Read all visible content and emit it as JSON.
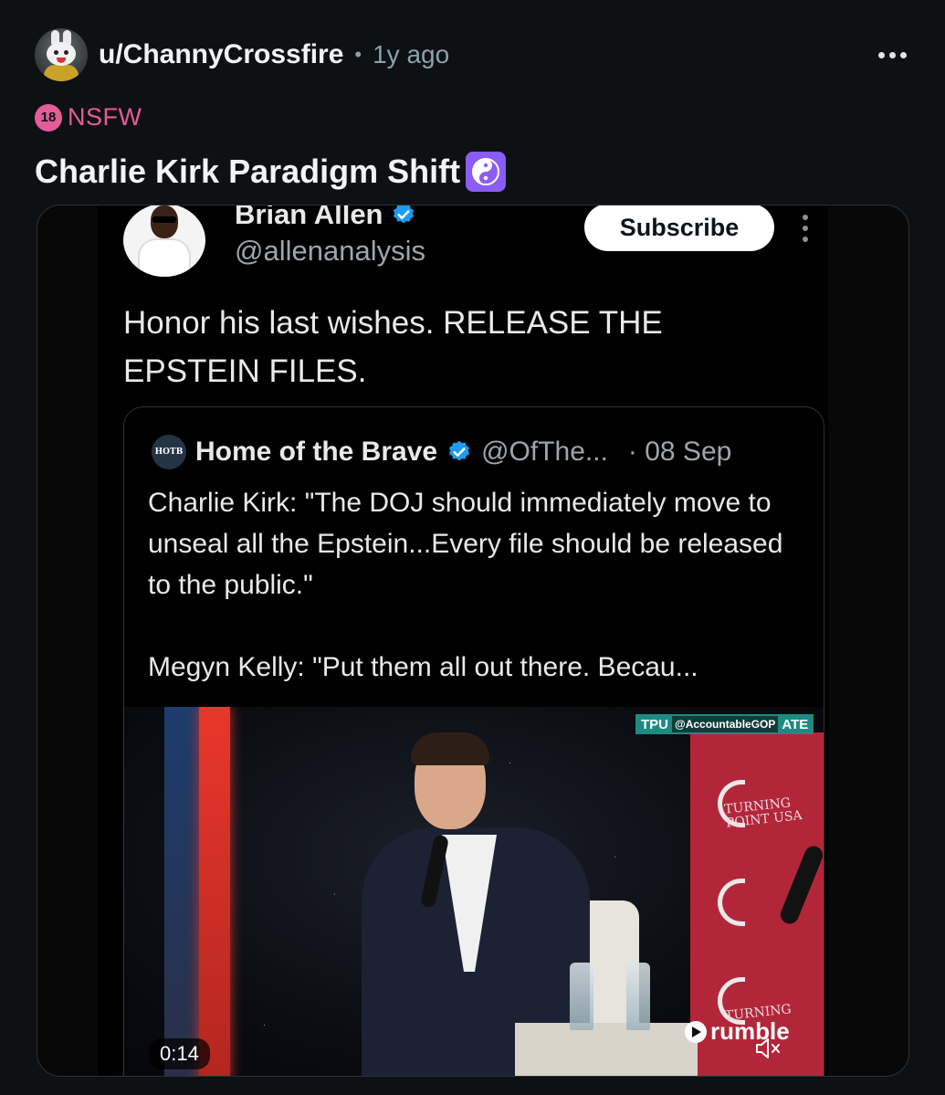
{
  "post": {
    "username": "u/ChannyCrossfire",
    "separator": "•",
    "time_ago": "1y ago",
    "nsfw_badge": "18",
    "nsfw_label": "NSFW",
    "title": "Charlie Kirk Paradigm Shift",
    "title_emoji": "yin-yang-icon",
    "accent_color": "#e65b9a"
  },
  "tweet": {
    "display_name": "Brian Allen",
    "handle": "@allenanalysis",
    "subscribe_label": "Subscribe",
    "text": "Honor his last wishes. RELEASE THE EPSTEIN FILES."
  },
  "quote": {
    "logo_text": "HOTB",
    "name": "Home of the Brave",
    "handle": "@OfThe...",
    "date": "· 08 Sep",
    "paragraph_1": "Charlie Kirk: \"The DOJ should immediately move to unseal all the Epstein...Every file should be released to the public.\"",
    "paragraph_2": "Megyn Kelly: \"Put them all out there. Becau..."
  },
  "video": {
    "watermark_left": "TPU",
    "watermark_handle": "@AccountableGOP",
    "watermark_right": "ATE",
    "banner_text": "TURNING POINT USA",
    "banner_text_2": "TURNING",
    "brand": "rumble",
    "timecode": "0:14",
    "mute_icon": "speaker-muted-icon",
    "progress": 0.14
  }
}
